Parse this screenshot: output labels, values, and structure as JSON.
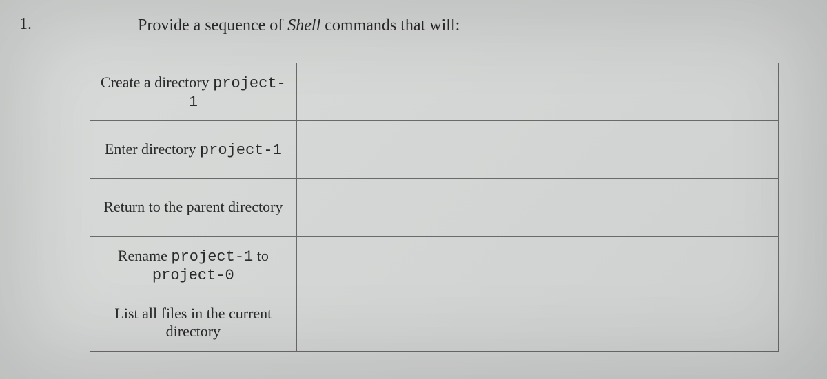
{
  "question": {
    "number": "1.",
    "prompt_before": "Provide a sequence of ",
    "prompt_italic": "Shell",
    "prompt_after": " commands that will:"
  },
  "rows": [
    {
      "pre": "Create a directory ",
      "code": "project-1",
      "post": "",
      "answer": ""
    },
    {
      "pre": "Enter directory ",
      "code": "project-1",
      "post": "",
      "answer": ""
    },
    {
      "pre": "Return to the parent directory",
      "code": "",
      "post": "",
      "answer": ""
    },
    {
      "pre": "Rename ",
      "code": "project-1",
      "post": " to ",
      "code2": "project-0",
      "answer": ""
    },
    {
      "pre": "List all files in the current directory",
      "code": "",
      "post": "",
      "answer": ""
    }
  ]
}
